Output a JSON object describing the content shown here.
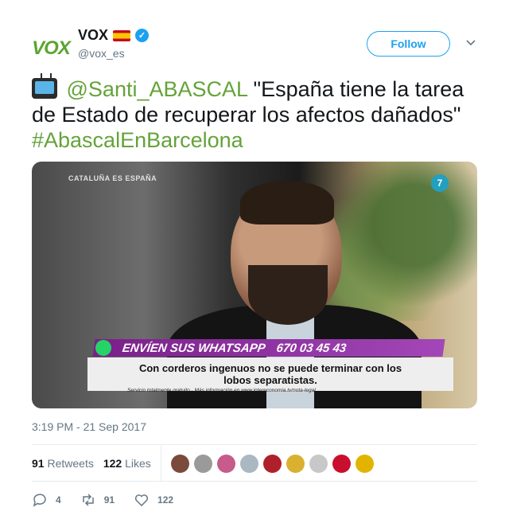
{
  "account": {
    "display_name": "VOX",
    "handle": "@vox_es",
    "logo_text": "VOX",
    "follow_label": "Follow",
    "flag_icon": "spain-flag-icon",
    "verified_icon": "verified-badge-icon"
  },
  "tweet": {
    "tv_icon": "television-icon",
    "mention": "@Santi_ABASCAL",
    "text": " \"España tiene la tarea de Estado de recuperar los afectos dañados\" ",
    "hashtag": "#AbascalEnBarcelona"
  },
  "media": {
    "corner_label": "CATALUÑA ES ESPAÑA",
    "channel_logo": "7",
    "whatsapp_label": "ENVÍEN SUS WHATSAPP",
    "whatsapp_number": "670 03 45 43",
    "caption_line1": "Con corderos ingenuos no se puede terminar con los",
    "caption_line2": "lobos separatistas.",
    "caption_small": "Servicio totalmente gratuito · Más información en www.intereconomia.tv/nota-legal"
  },
  "timestamp": "3:19 PM - 21 Sep 2017",
  "stats": {
    "retweets_count": "91",
    "retweets_label": "Retweets",
    "likes_count": "122",
    "likes_label": "Likes"
  },
  "likers": [
    {
      "color": "#7a4a3a"
    },
    {
      "color": "#9a9a9a"
    },
    {
      "color": "#c65b8c"
    },
    {
      "color": "#aab8c2"
    },
    {
      "color": "#b0202a"
    },
    {
      "color": "#d9b030"
    },
    {
      "color": "#c8c8c8"
    },
    {
      "color": "#c8102e"
    },
    {
      "color": "#e2b400"
    }
  ],
  "actions": {
    "reply_count": "4",
    "retweet_count": "91",
    "like_count": "122"
  },
  "colors": {
    "accent": "#1da1f2",
    "hashtag_green": "#64a33a",
    "muted": "#657786"
  }
}
